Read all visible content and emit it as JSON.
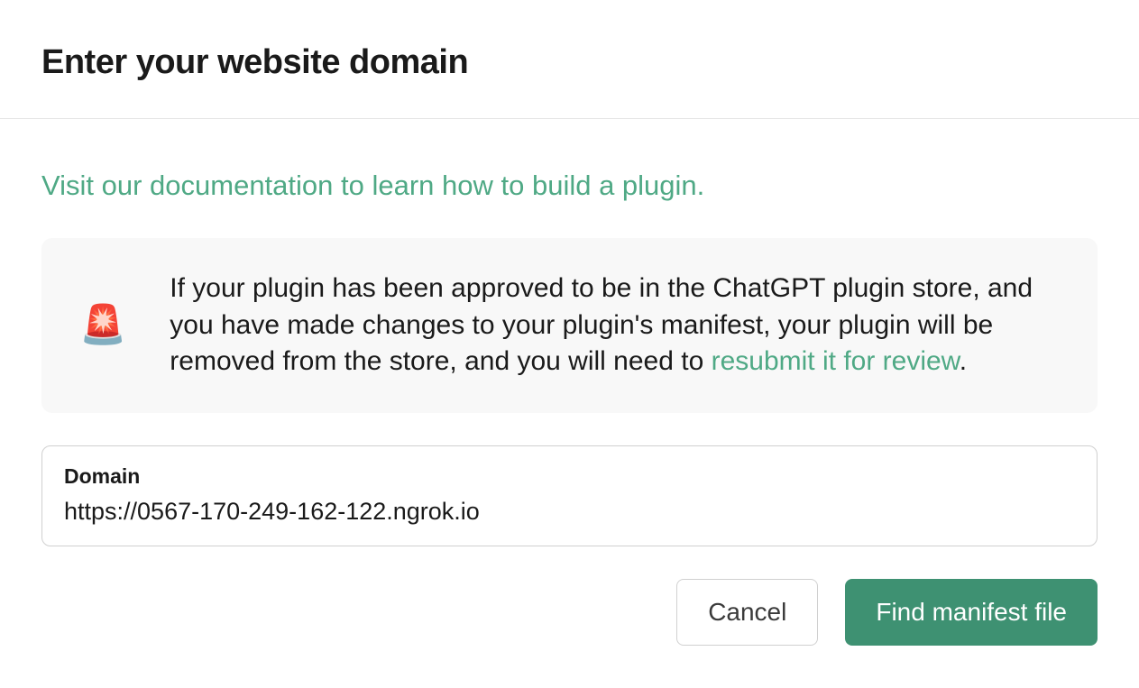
{
  "modal": {
    "title": "Enter your website domain",
    "doc_link_text": "Visit our documentation to learn how to build a plugin.",
    "warning": {
      "icon": "🚨",
      "text_before": "If your plugin has been approved to be in the ChatGPT plugin store, and you have made changes to your plugin's manifest, your plugin will be removed from the store, and you will need to ",
      "link_text": "resubmit it for review",
      "text_after": "."
    },
    "domain_field": {
      "label": "Domain",
      "value": "https://0567-170-249-162-122.ngrok.io"
    },
    "actions": {
      "cancel": "Cancel",
      "submit": "Find manifest file"
    }
  }
}
